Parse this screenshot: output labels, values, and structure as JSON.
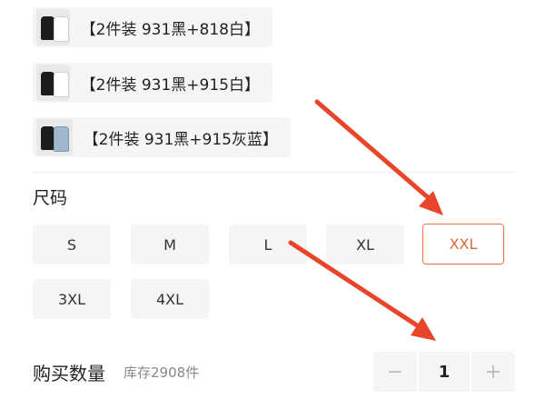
{
  "colors_section": {
    "options": [
      {
        "label": "【2件装 931黑+818白】",
        "thumb_icon": "shirt-pair-black-white"
      },
      {
        "label": "【2件装 931黑+915白】",
        "thumb_icon": "shirt-pair-black-white"
      },
      {
        "label": "【2件装 931黑+915灰蓝】",
        "thumb_icon": "shirt-pair-black-grayblue"
      }
    ]
  },
  "size_section": {
    "title": "尺码",
    "sizes": [
      "S",
      "M",
      "L",
      "XL",
      "XXL",
      "3XL",
      "4XL"
    ],
    "selected": "XXL"
  },
  "quantity_section": {
    "label": "购买数量",
    "stock": "库存2908件",
    "minus": "−",
    "value": "1",
    "plus": "+"
  },
  "theme": {
    "accent": "#e2673b",
    "option_bg": "#f5f5f5",
    "annotation_arrow": "#e8452a"
  }
}
